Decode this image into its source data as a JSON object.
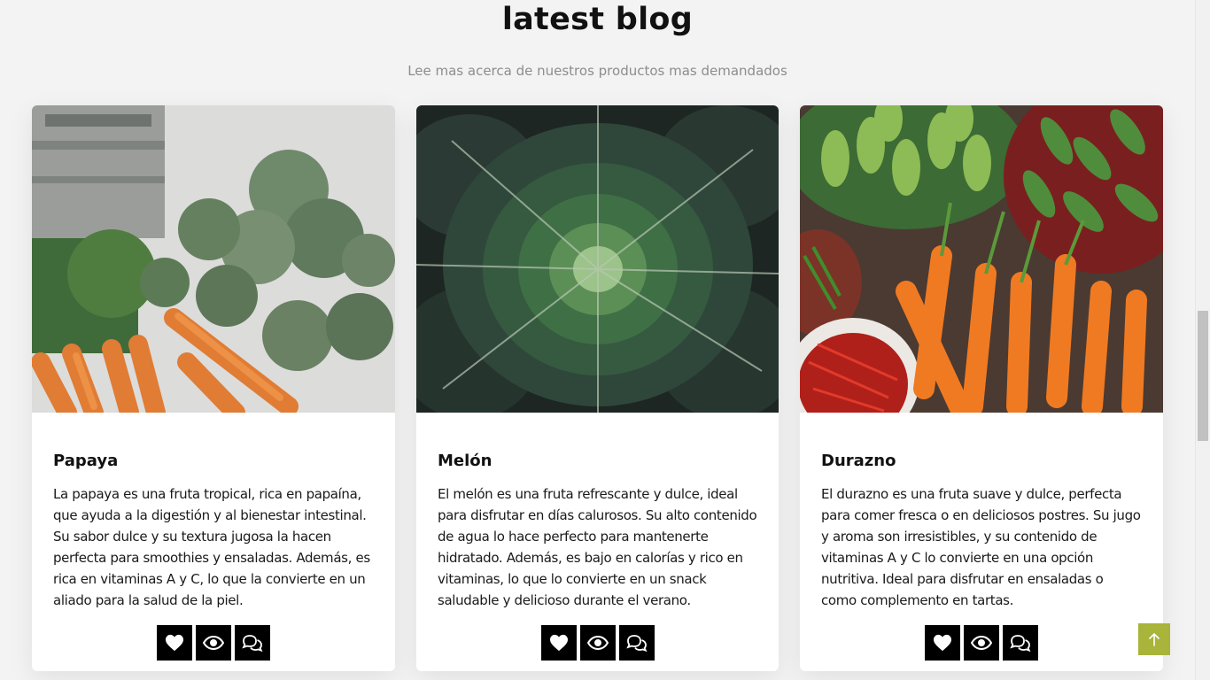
{
  "header": {
    "title": "latest blog",
    "subtitle": "Lee mas acerca de nuestros productos mas demandados"
  },
  "cards": [
    {
      "title": "Papaya",
      "text": "La papaya es una fruta tropical, rica en papaína, que ayuda a la digestión y al bienestar intestinal. Su sabor dulce y su textura jugosa la hacen perfecta para smoothies y ensaladas. Además, es rica en vitaminas A y C, lo que la convierte en un aliado para la salud de la piel.",
      "image": "artichokes-and-carrots-photo"
    },
    {
      "title": "Melón",
      "text": "El melón es una fruta refrescante y dulce, ideal para disfrutar en días calurosos. Su alto contenido de agua lo hace perfecto para mantenerte hidratado. Además, es bajo en calorías y rico en vitaminas, lo que lo convierte en un snack saludable y delicioso durante el verano.",
      "image": "cabbage-photo"
    },
    {
      "title": "Durazno",
      "text": "El durazno es una fruta suave y dulce, perfecta para comer fresca o en deliciosos postres. Su jugo y aroma son irresistibles, y su contenido de vitaminas A y C lo convierte en una opción nutritiva. Ideal para disfrutar en ensaladas o como complemento en tartas.",
      "image": "market-vegetables-photo"
    }
  ],
  "card_actions": [
    "heart-icon",
    "eye-icon",
    "comments-icon"
  ],
  "scroll_top_icon": "arrow-up-icon",
  "colors": {
    "background": "#f3f3f3",
    "card": "#ffffff",
    "action_button": "#000000",
    "scroll_top": "#a8b43a",
    "subtitle": "#8d8d8d"
  }
}
